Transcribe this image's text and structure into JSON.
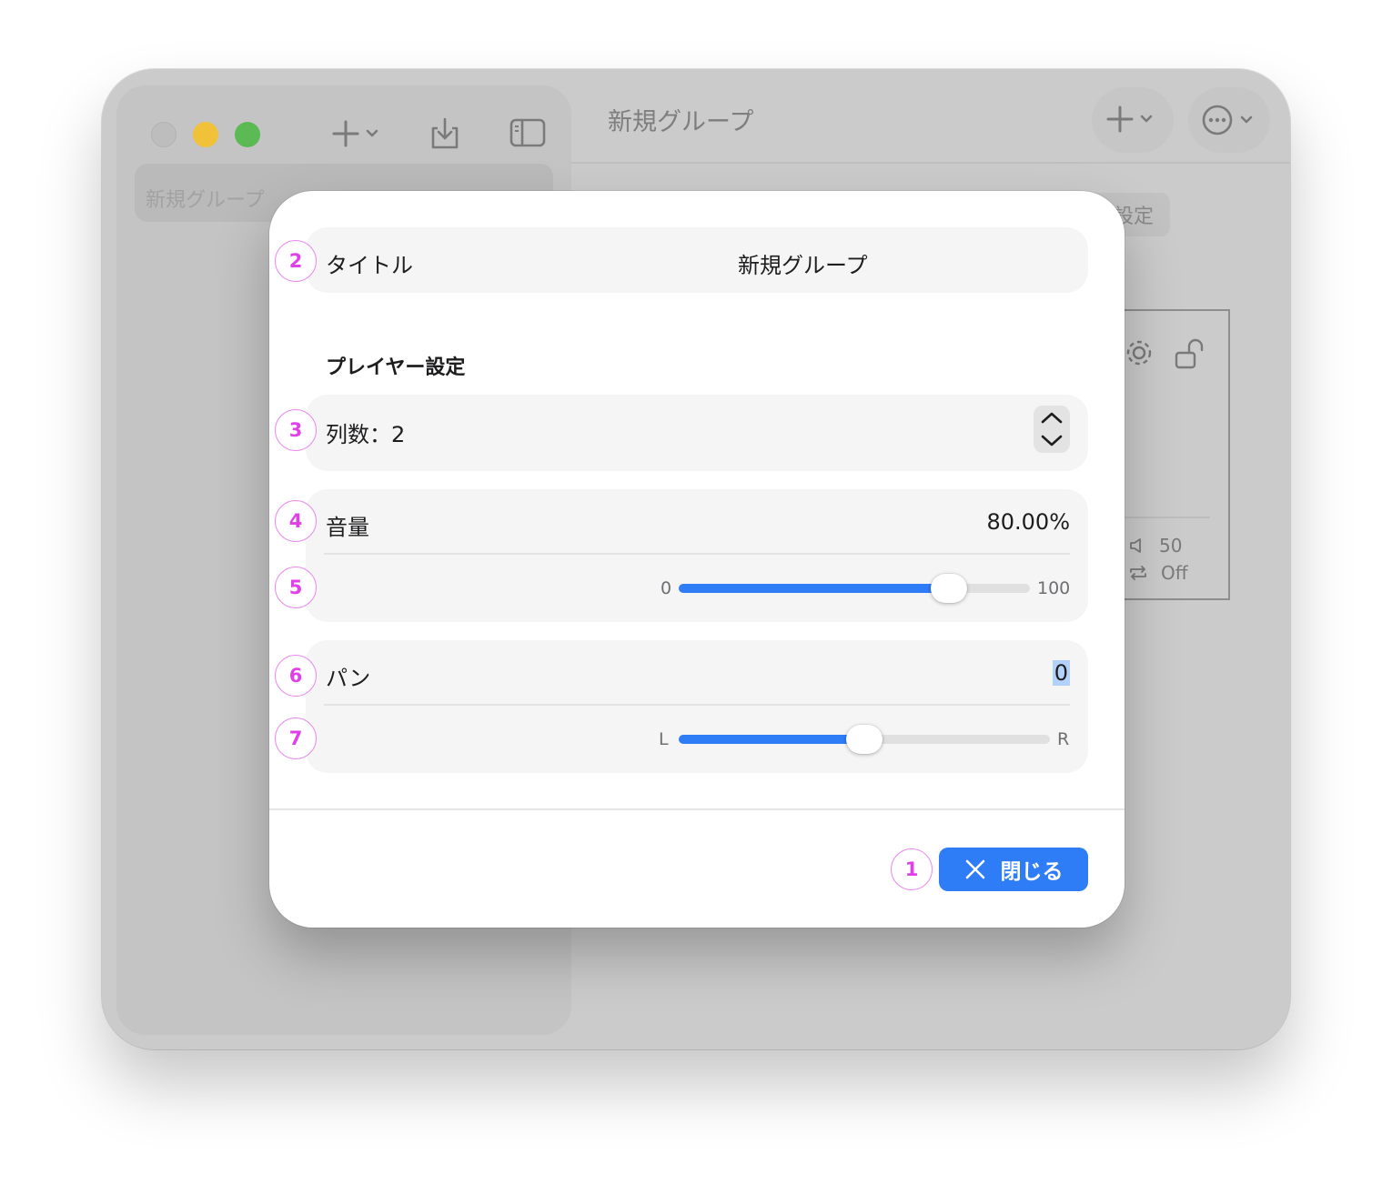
{
  "window": {
    "sidebar": {
      "items": [
        {
          "label": "新規グループ"
        }
      ]
    },
    "main": {
      "title": "新規グループ",
      "settings_button_partial": "設定",
      "card": {
        "volume_value": "50",
        "repeat_value": "Off"
      }
    },
    "toolbar_icons": [
      "plus-icon",
      "chevron-down-icon",
      "download-icon",
      "sidebar-toggle-icon",
      "more-icon"
    ]
  },
  "modal": {
    "title_row": {
      "label": "タイトル",
      "value": "新規グループ"
    },
    "section_title": "プレイヤー設定",
    "columns": {
      "label": "列数：2"
    },
    "volume": {
      "label": "音量",
      "value_text": "80.00%",
      "slider_min": "0",
      "slider_max": "100",
      "slider_value": 0.77
    },
    "pan": {
      "label": "パン",
      "value_text": "0",
      "slider_min": "L",
      "slider_max": "R",
      "slider_value": 0.5
    },
    "close_button": {
      "label": "閉じる"
    }
  },
  "badges": [
    "1",
    "2",
    "3",
    "4",
    "5",
    "6",
    "7"
  ],
  "colors": {
    "accent": "#2e7cf6",
    "badge": "#e040e8",
    "traffic_yellow": "#f2c13a",
    "traffic_green": "#5cba55"
  }
}
